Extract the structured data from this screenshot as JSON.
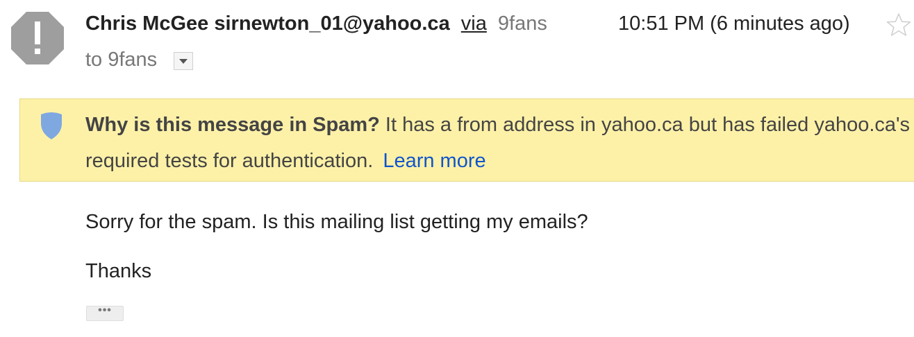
{
  "header": {
    "sender_name": "Chris McGee",
    "sender_email": "sirnewton_01@yahoo.ca",
    "via_label": "via",
    "via_list": "9fans",
    "timestamp": "10:51 PM (6 minutes ago)",
    "recipients": "to 9fans",
    "avatar_icon": "exclamation-octagon-icon",
    "star_icon": "star-outline-icon",
    "details_icon": "caret-down-icon"
  },
  "spam_banner": {
    "question": "Why is this message in Spam?",
    "explanation_line1": "It has a from address in yahoo.ca but has failed yahoo.ca's",
    "explanation_line2": "required tests for authentication.",
    "learn_more": "Learn more",
    "icon": "shield-icon"
  },
  "message_body": {
    "line1": "Sorry for the spam. Is this mailing list getting my emails?",
    "line2": "Thanks",
    "trimmed_content_label": "•••"
  },
  "colors": {
    "banner_background": "#fdf1a8",
    "link": "#1155cc",
    "shield": "#7fa8e0",
    "avatar": "#9e9e9e"
  }
}
